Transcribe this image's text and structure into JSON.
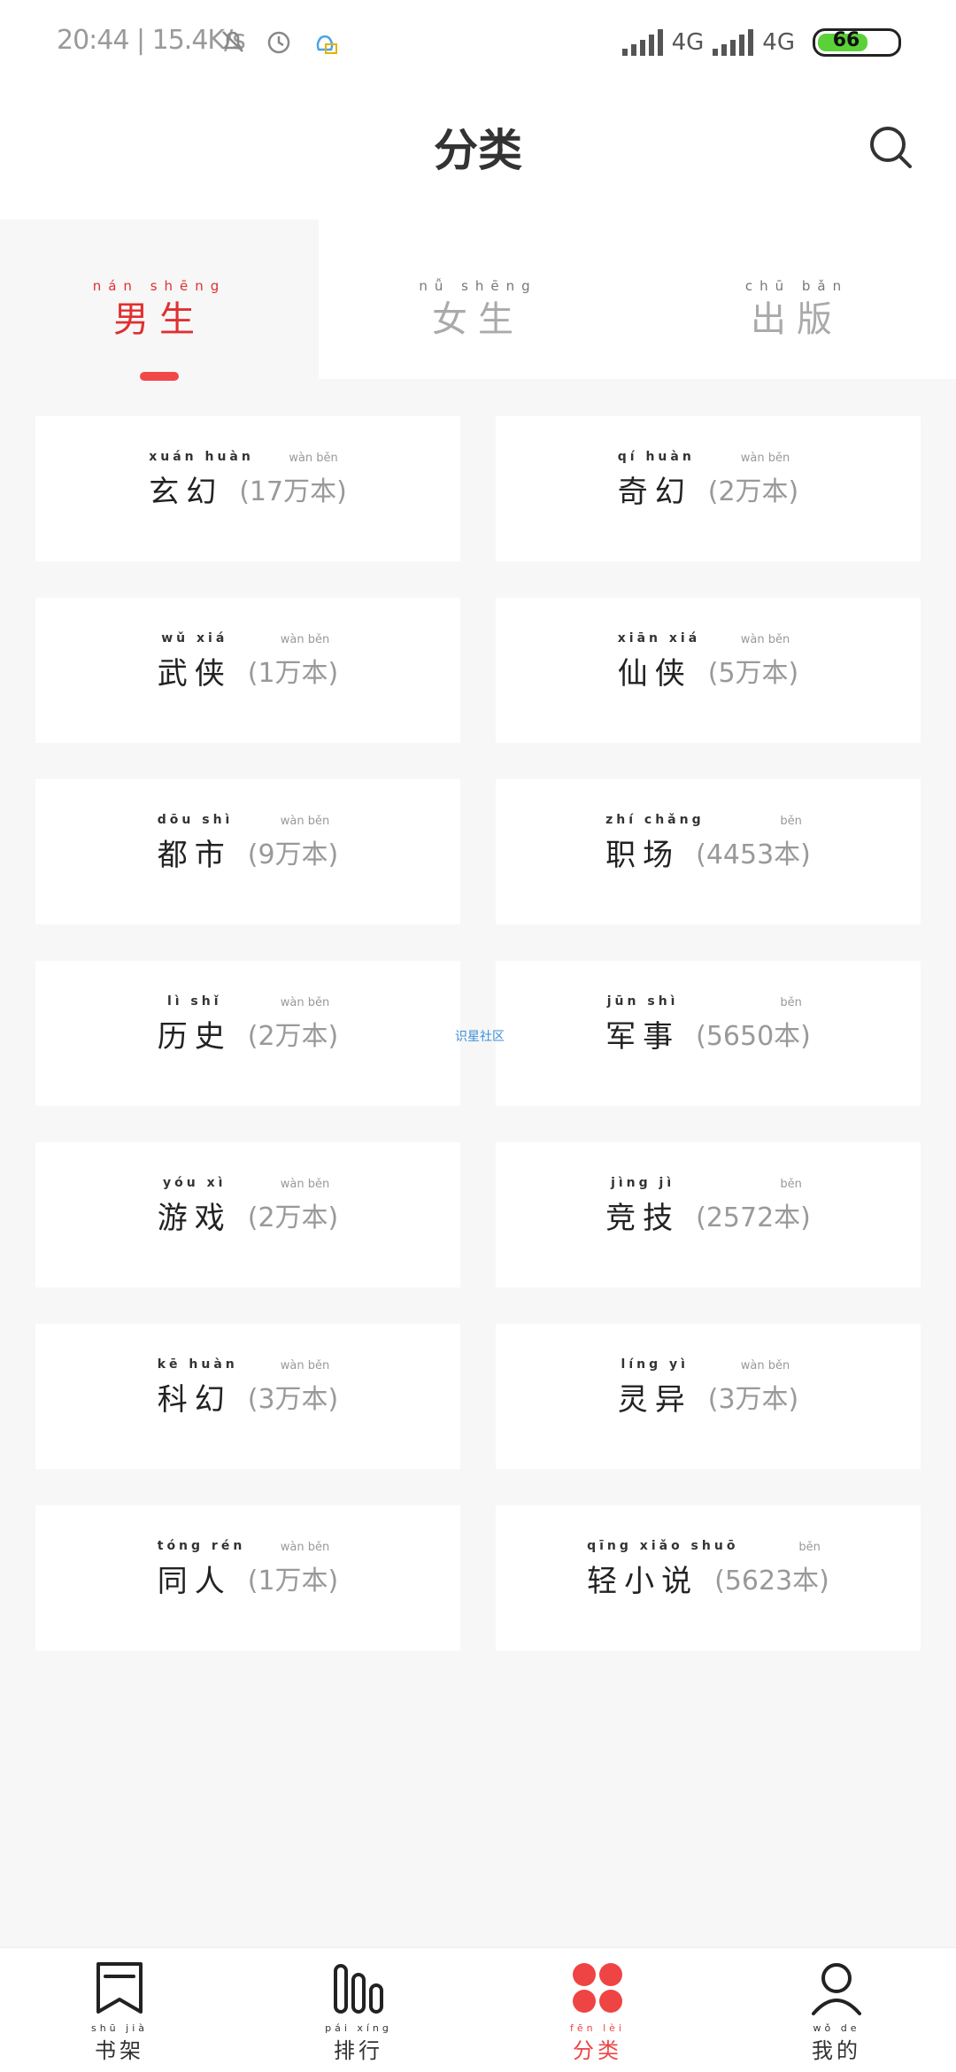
{
  "status": {
    "time_speed": "20:44 | 15.4K/s",
    "net1": "4G",
    "net2": "4G",
    "battery": "66"
  },
  "header": {
    "title": "分类"
  },
  "tabs": [
    {
      "pinyin": "nán shēng",
      "label": "男生",
      "active": true
    },
    {
      "pinyin": "nǚ shēng",
      "label": "女生",
      "active": false
    },
    {
      "pinyin": "chū bǎn",
      "label": "出版",
      "active": false
    }
  ],
  "categories": [
    {
      "pinyin": "xuán huàn",
      "name": "玄幻",
      "count_pinyin": "wàn běn",
      "count": "(17万本)"
    },
    {
      "pinyin": "qí huàn",
      "name": "奇幻",
      "count_pinyin": "wàn běn",
      "count": "(2万本)"
    },
    {
      "pinyin": "wǔ xiá",
      "name": "武侠",
      "count_pinyin": "wàn běn",
      "count": "(1万本)"
    },
    {
      "pinyin": "xiān xiá",
      "name": "仙侠",
      "count_pinyin": "wàn běn",
      "count": "(5万本)"
    },
    {
      "pinyin": "dōu shì",
      "name": "都市",
      "count_pinyin": "wàn běn",
      "count": "(9万本)"
    },
    {
      "pinyin": "zhí chǎng",
      "name": "职场",
      "count_pinyin": "běn",
      "count": "(4453本)"
    },
    {
      "pinyin": "lì shǐ",
      "name": "历史",
      "count_pinyin": "wàn běn",
      "count": "(2万本)"
    },
    {
      "pinyin": "jūn shì",
      "name": "军事",
      "count_pinyin": "běn",
      "count": "(5650本)"
    },
    {
      "pinyin": "yóu xì",
      "name": "游戏",
      "count_pinyin": "wàn běn",
      "count": "(2万本)"
    },
    {
      "pinyin": "jìng jì",
      "name": "竞技",
      "count_pinyin": "běn",
      "count": "(2572本)"
    },
    {
      "pinyin": "kē huàn",
      "name": "科幻",
      "count_pinyin": "wàn běn",
      "count": "(3万本)"
    },
    {
      "pinyin": "líng yì",
      "name": "灵异",
      "count_pinyin": "wàn běn",
      "count": "(3万本)"
    },
    {
      "pinyin": "tóng rén",
      "name": "同人",
      "count_pinyin": "wàn běn",
      "count": "(1万本)"
    },
    {
      "pinyin": "qīng xiǎo shuō",
      "name": "轻小说",
      "count_pinyin": "běn",
      "count": "(5623本)"
    }
  ],
  "watermark": "识星社区",
  "bottom_nav": [
    {
      "pinyin": "shū jià",
      "label": "书架",
      "icon": "bookshelf-icon",
      "active": false
    },
    {
      "pinyin": "pái xíng",
      "label": "排行",
      "icon": "ranking-icon",
      "active": false
    },
    {
      "pinyin": "fēn lèi",
      "label": "分类",
      "icon": "category-icon",
      "active": true
    },
    {
      "pinyin": "wǒ de",
      "label": "我的",
      "icon": "profile-icon",
      "active": false
    }
  ],
  "colors": {
    "accent": "#ef4444",
    "muted": "#999999"
  }
}
